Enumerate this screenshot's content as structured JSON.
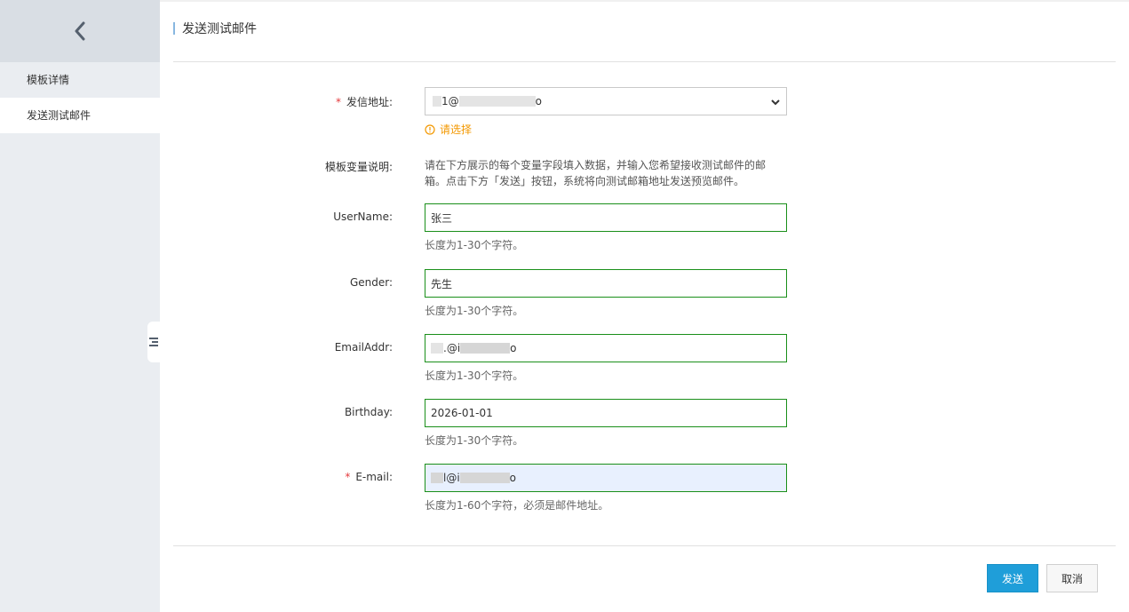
{
  "sidebar": {
    "items": [
      {
        "label": "模板详情",
        "active": false
      },
      {
        "label": "发送测试邮件",
        "active": true
      }
    ]
  },
  "page": {
    "title": "发送测试邮件"
  },
  "form": {
    "sender": {
      "label": "发信地址:",
      "required": true,
      "value_prefix": "1@",
      "value_suffix": "o",
      "warning": "请选择"
    },
    "template_vars": {
      "label": "模板变量说明:",
      "text": "请在下方展示的每个变量字段填入数据，并输入您希望接收测试邮件的邮箱。点击下方「发送」按钮，系统将向测试邮箱地址发送预览邮件。"
    },
    "fields": [
      {
        "label": "UserName:",
        "value": "张三",
        "hint": "长度为1-30个字符。"
      },
      {
        "label": "Gender:",
        "value": "先生",
        "hint": "长度为1-30个字符。"
      },
      {
        "label": "EmailAddr:",
        "value_prefix": ".@i",
        "value_suffix": "o",
        "hint": "长度为1-30个字符。"
      },
      {
        "label": "Birthday:",
        "value": "2026-01-01",
        "hint": "长度为1-30个字符。"
      }
    ],
    "email": {
      "label": "E-mail:",
      "required": true,
      "value_prefix": "l@i",
      "value_suffix": "o",
      "hint": "长度为1-60个字符，必须是邮件地址。"
    }
  },
  "actions": {
    "send": "发送",
    "cancel": "取消"
  },
  "colors": {
    "primary": "#1f9ed9",
    "warning": "#f39800",
    "required": "#e4393c",
    "valid_border": "#1a8f1a"
  }
}
